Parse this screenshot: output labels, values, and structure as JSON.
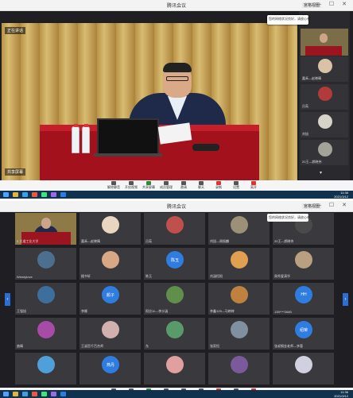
{
  "window": {
    "title": "腾讯会议",
    "view_label": "宫格视图",
    "controls": "— ☐ ✕"
  },
  "shot1": {
    "speaker_tag": "正在讲话",
    "grid_toggle": "共享屏幕",
    "notice": "您的网络状况良好，请放心参会",
    "side_tiles": [
      {
        "label": "大道工业大学",
        "color": "#7a6d47"
      },
      {
        "label": "嘉禾—赵晓晴",
        "color": "#d9c2a5"
      },
      {
        "label": "吕苑",
        "color": "#b13a3a"
      },
      {
        "label": "刘旭",
        "color": "#d8d3c9"
      },
      {
        "label": "20王—颜晓伟",
        "color": "#a3a39a"
      },
      {
        "label": "",
        "color": "#c8c8c8"
      }
    ]
  },
  "toolbar": {
    "items": [
      {
        "label": "解除静音",
        "icon": "mic-icon",
        "color": "#555"
      },
      {
        "label": "开启视频",
        "icon": "camera-icon",
        "color": "#555"
      },
      {
        "label": "共享屏幕",
        "icon": "share-icon",
        "color": "#2a8a3a"
      },
      {
        "label": "成员管理",
        "icon": "members-icon",
        "color": "#555"
      },
      {
        "label": "邀请",
        "icon": "invite-icon",
        "color": "#555"
      },
      {
        "label": "聊天",
        "icon": "chat-icon",
        "color": "#555"
      },
      {
        "label": "录制",
        "icon": "record-icon",
        "color": "#d33"
      },
      {
        "label": "设置",
        "icon": "settings-icon",
        "color": "#555"
      },
      {
        "label": "离开",
        "icon": "leave-icon",
        "color": "#d33"
      }
    ]
  },
  "taskbar": {
    "time": "11:36",
    "date": "2021/3/12"
  },
  "shot2": {
    "notice": "您的网络状况良好，请放心参会",
    "arrow_left": "‹",
    "arrow_right": "›",
    "tiles": [
      {
        "label": "9 大道工业大学",
        "avatar_text": "",
        "color": "#8d7a46",
        "video": true
      },
      {
        "label": "嘉禾—赵晓晴",
        "avatar_text": "",
        "color": "#e8d6c0"
      },
      {
        "label": "吕苑",
        "avatar_text": "",
        "color": "#c0504d"
      },
      {
        "label": "刘旭—周振麟",
        "avatar_text": "",
        "color": "#9d9078"
      },
      {
        "label": "20王—颜晓伟",
        "avatar_text": "",
        "color": "#4a4a4a"
      },
      {
        "label": "Wendylove",
        "avatar_text": "",
        "color": "#4c6f8f"
      },
      {
        "label": "楼书轩",
        "avatar_text": "",
        "color": "#d8a784"
      },
      {
        "label": "陈玉",
        "avatar_text": "陈玉",
        "color": "#2f7de1"
      },
      {
        "label": "刘涵恒阳",
        "avatar_text": "",
        "color": "#e0a050"
      },
      {
        "label": "周秀爱清华",
        "avatar_text": "",
        "color": "#b8a080"
      },
      {
        "label": "王强旭",
        "avatar_text": "",
        "color": "#3d6f9c"
      },
      {
        "label": "李娜",
        "avatar_text": "颜子",
        "color": "#2f7de1"
      },
      {
        "label": "阳谷11—李沙涵",
        "avatar_text": "",
        "color": "#5f8f4a"
      },
      {
        "label": "李鑫125—马婷婷",
        "avatar_text": "",
        "color": "#c08040"
      },
      {
        "label": "135****2680",
        "avatar_text": "HH",
        "color": "#2f7de1"
      },
      {
        "label": "曲晴",
        "avatar_text": "",
        "color": "#a84aa8"
      },
      {
        "label": "王淑哲千百合师",
        "avatar_text": "",
        "color": "#d3b0b0"
      },
      {
        "label": "东",
        "avatar_text": "",
        "color": "#5a9a6a"
      },
      {
        "label": "张家恒",
        "avatar_text": "",
        "color": "#8090a0"
      },
      {
        "label": "张叔钢金老师—李蓉",
        "avatar_text": "绍荣",
        "color": "#2f7de1"
      },
      {
        "label": "",
        "avatar_text": "",
        "color": "#4fa0d8"
      },
      {
        "label": "",
        "avatar_text": "燕丹",
        "color": "#2f7de1"
      },
      {
        "label": "",
        "avatar_text": "",
        "color": "#e0a0a0"
      },
      {
        "label": "",
        "avatar_text": "",
        "color": "#7a5a9a"
      },
      {
        "label": "",
        "avatar_text": "",
        "color": "#d0d0e0"
      }
    ]
  }
}
